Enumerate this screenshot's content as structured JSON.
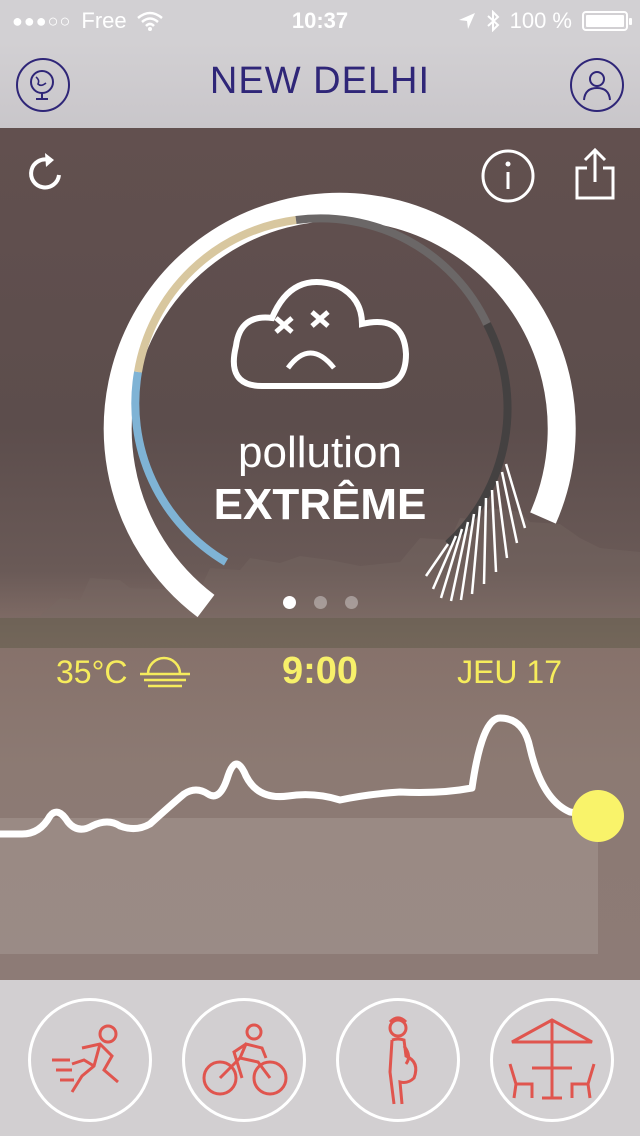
{
  "status_bar": {
    "signal_dots": "●●●○○",
    "carrier": "Free",
    "time": "10:37",
    "battery": "100 %",
    "battery_level": 1.0
  },
  "header": {
    "city": "NEW DELHI",
    "left_icon": "globe-icon",
    "right_icon": "user-icon"
  },
  "gauge": {
    "status_label": "pollution",
    "status_level": "EXTRÊME",
    "face_icon": "sad-cloud-icon"
  },
  "pager": {
    "pages": 3,
    "active": 0
  },
  "weather": {
    "temperature": "35°C",
    "weather_icon": "hazy-sun-icon",
    "time": "9:00",
    "day": "JEU 17"
  },
  "activities": [
    {
      "name": "running",
      "icon": "runner-icon"
    },
    {
      "name": "cycling",
      "icon": "cyclist-icon"
    },
    {
      "name": "pregnancy",
      "icon": "pregnant-woman-icon"
    },
    {
      "name": "terrace",
      "icon": "terrace-table-icon"
    }
  ],
  "colors": {
    "header_text": "#2f2678",
    "accent_yellow": "#f6ec5c",
    "activity_icon": "#e0554e",
    "gauge_blue": "#7fb3d5",
    "gauge_tan": "#d9c9a3"
  }
}
